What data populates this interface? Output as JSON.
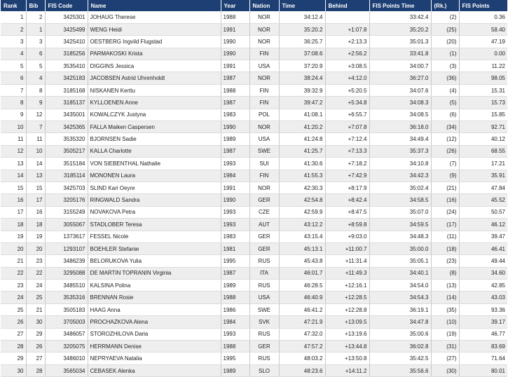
{
  "headers": {
    "rank": "Rank",
    "bib": "Bib",
    "fis_code": "FIS Code",
    "name": "Name",
    "year": "Year",
    "nation": "Nation",
    "time": "Time",
    "behind": "Behind",
    "fis_points_time": "FIS Points Time",
    "rk": "(Rk.)",
    "fis_points": "FIS Points"
  },
  "rows": [
    {
      "rank": "1",
      "bib": "2",
      "code": "3425301",
      "name": "JOHAUG Therese",
      "year": "1988",
      "nation": "NOR",
      "time": "34:12.4",
      "behind": "",
      "pt": "33:42.4",
      "rk": "(2)",
      "pts": "0.36"
    },
    {
      "rank": "2",
      "bib": "1",
      "code": "3425499",
      "name": "WENG Heidi",
      "year": "1991",
      "nation": "NOR",
      "time": "35:20.2",
      "behind": "+1:07.8",
      "pt": "35:20.2",
      "rk": "(25)",
      "pts": "58.40"
    },
    {
      "rank": "3",
      "bib": "3",
      "code": "3425410",
      "name": "OESTBERG Ingvild Flugstad",
      "year": "1990",
      "nation": "NOR",
      "time": "36:25.7",
      "behind": "+2:13.3",
      "pt": "35:01.3",
      "rk": "(20)",
      "pts": "47.19"
    },
    {
      "rank": "4",
      "bib": "6",
      "code": "3185256",
      "name": "PARMAKOSKI Krista",
      "year": "1990",
      "nation": "FIN",
      "time": "37:08.6",
      "behind": "+2:56.2",
      "pt": "33:41.8",
      "rk": "(1)",
      "pts": "0.00"
    },
    {
      "rank": "5",
      "bib": "5",
      "code": "3535410",
      "name": "DIGGINS Jessica",
      "year": "1991",
      "nation": "USA",
      "time": "37:20.9",
      "behind": "+3:08.5",
      "pt": "34:00.7",
      "rk": "(3)",
      "pts": "11.22"
    },
    {
      "rank": "6",
      "bib": "4",
      "code": "3425183",
      "name": "JACOBSEN Astrid Uhrenholdt",
      "year": "1987",
      "nation": "NOR",
      "time": "38:24.4",
      "behind": "+4:12.0",
      "pt": "36:27.0",
      "rk": "(36)",
      "pts": "98.05"
    },
    {
      "rank": "7",
      "bib": "8",
      "code": "3185168",
      "name": "NISKANEN Kerttu",
      "year": "1988",
      "nation": "FIN",
      "time": "39:32.9",
      "behind": "+5:20.5",
      "pt": "34:07.6",
      "rk": "(4)",
      "pts": "15.31"
    },
    {
      "rank": "8",
      "bib": "9",
      "code": "3185137",
      "name": "KYLLOENEN Anne",
      "year": "1987",
      "nation": "FIN",
      "time": "39:47.2",
      "behind": "+5:34.8",
      "pt": "34:08.3",
      "rk": "(5)",
      "pts": "15.73"
    },
    {
      "rank": "9",
      "bib": "12",
      "code": "3435001",
      "name": "KOWALCZYK Justyna",
      "year": "1983",
      "nation": "POL",
      "time": "41:08.1",
      "behind": "+6:55.7",
      "pt": "34:08.5",
      "rk": "(6)",
      "pts": "15.85"
    },
    {
      "rank": "10",
      "bib": "7",
      "code": "3425365",
      "name": "FALLA Maiken Caspersen",
      "year": "1990",
      "nation": "NOR",
      "time": "41:20.2",
      "behind": "+7:07.8",
      "pt": "36:18.0",
      "rk": "(34)",
      "pts": "92.71"
    },
    {
      "rank": "11",
      "bib": "11",
      "code": "3535320",
      "name": "BJORNSEN Sadie",
      "year": "1989",
      "nation": "USA",
      "time": "41:24.8",
      "behind": "+7:12.4",
      "pt": "34:49.4",
      "rk": "(12)",
      "pts": "40.12"
    },
    {
      "rank": "12",
      "bib": "10",
      "code": "3505217",
      "name": "KALLA Charlotte",
      "year": "1987",
      "nation": "SWE",
      "time": "41:25.7",
      "behind": "+7:13.3",
      "pt": "35:37.3",
      "rk": "(26)",
      "pts": "68.55"
    },
    {
      "rank": "13",
      "bib": "14",
      "code": "3515184",
      "name": "VON SIEBENTHAL Nathalie",
      "year": "1993",
      "nation": "SUI",
      "time": "41:30.6",
      "behind": "+7:18.2",
      "pt": "34:10.8",
      "rk": "(7)",
      "pts": "17.21"
    },
    {
      "rank": "14",
      "bib": "13",
      "code": "3185114",
      "name": "MONONEN Laura",
      "year": "1984",
      "nation": "FIN",
      "time": "41:55.3",
      "behind": "+7:42.9",
      "pt": "34:42.3",
      "rk": "(9)",
      "pts": "35.91"
    },
    {
      "rank": "15",
      "bib": "15",
      "code": "3425703",
      "name": "SLIND Kari Oeyre",
      "year": "1991",
      "nation": "NOR",
      "time": "42:30.3",
      "behind": "+8:17.9",
      "pt": "35:02.4",
      "rk": "(21)",
      "pts": "47.84"
    },
    {
      "rank": "16",
      "bib": "17",
      "code": "3205176",
      "name": "RINGWALD Sandra",
      "year": "1990",
      "nation": "GER",
      "time": "42:54.8",
      "behind": "+8:42.4",
      "pt": "34:58.5",
      "rk": "(16)",
      "pts": "45.52"
    },
    {
      "rank": "17",
      "bib": "16",
      "code": "3155249",
      "name": "NOVAKOVA Petra",
      "year": "1993",
      "nation": "CZE",
      "time": "42:59.9",
      "behind": "+8:47.5",
      "pt": "35:07.0",
      "rk": "(24)",
      "pts": "50.57"
    },
    {
      "rank": "18",
      "bib": "18",
      "code": "3055067",
      "name": "STADLOBER Teresa",
      "year": "1993",
      "nation": "AUT",
      "time": "43:12.2",
      "behind": "+8:59.8",
      "pt": "34:59.5",
      "rk": "(17)",
      "pts": "46.12"
    },
    {
      "rank": "19",
      "bib": "19",
      "code": "1373617",
      "name": "FESSEL Nicole",
      "year": "1983",
      "nation": "GER",
      "time": "43:15.4",
      "behind": "+9:03.0",
      "pt": "34:48.3",
      "rk": "(11)",
      "pts": "39.47"
    },
    {
      "rank": "20",
      "bib": "20",
      "code": "1293107",
      "name": "BOEHLER Stefanie",
      "year": "1981",
      "nation": "GER",
      "time": "45:13.1",
      "behind": "+11:00.7",
      "pt": "35:00.0",
      "rk": "(18)",
      "pts": "46.41"
    },
    {
      "rank": "21",
      "bib": "23",
      "code": "3486239",
      "name": "BELORUKOVA Yulia",
      "year": "1995",
      "nation": "RUS",
      "time": "45:43.8",
      "behind": "+11:31.4",
      "pt": "35:05.1",
      "rk": "(23)",
      "pts": "49.44"
    },
    {
      "rank": "22",
      "bib": "22",
      "code": "3295088",
      "name": "DE MARTIN TOPRANIN Virginia",
      "year": "1987",
      "nation": "ITA",
      "time": "46:01.7",
      "behind": "+11:49.3",
      "pt": "34:40.1",
      "rk": "(8)",
      "pts": "34.60"
    },
    {
      "rank": "23",
      "bib": "24",
      "code": "3485510",
      "name": "KALSINA Polina",
      "year": "1989",
      "nation": "RUS",
      "time": "46:28.5",
      "behind": "+12:16.1",
      "pt": "34:54.0",
      "rk": "(13)",
      "pts": "42.85"
    },
    {
      "rank": "24",
      "bib": "25",
      "code": "3535316",
      "name": "BRENNAN Rosie",
      "year": "1988",
      "nation": "USA",
      "time": "46:40.9",
      "behind": "+12:28.5",
      "pt": "34:54.3",
      "rk": "(14)",
      "pts": "43.03"
    },
    {
      "rank": "25",
      "bib": "21",
      "code": "3505183",
      "name": "HAAG Anna",
      "year": "1986",
      "nation": "SWE",
      "time": "46:41.2",
      "behind": "+12:28.8",
      "pt": "36:19.1",
      "rk": "(35)",
      "pts": "93.36"
    },
    {
      "rank": "26",
      "bib": "30",
      "code": "3705003",
      "name": "PROCHAZKOVA Alena",
      "year": "1984",
      "nation": "SVK",
      "time": "47:21.9",
      "behind": "+13:09.5",
      "pt": "34:47.8",
      "rk": "(10)",
      "pts": "39.17"
    },
    {
      "rank": "27",
      "bib": "29",
      "code": "3486057",
      "name": "STOROZHILOVA Daria",
      "year": "1993",
      "nation": "RUS",
      "time": "47:32.0",
      "behind": "+13:19.6",
      "pt": "35:00.6",
      "rk": "(19)",
      "pts": "46.77"
    },
    {
      "rank": "28",
      "bib": "26",
      "code": "3205075",
      "name": "HERRMANN Denise",
      "year": "1988",
      "nation": "GER",
      "time": "47:57.2",
      "behind": "+13:44.8",
      "pt": "36:02.8",
      "rk": "(31)",
      "pts": "83.69"
    },
    {
      "rank": "29",
      "bib": "27",
      "code": "3486010",
      "name": "NEPRYAEVA Natalia",
      "year": "1995",
      "nation": "RUS",
      "time": "48:03.2",
      "behind": "+13:50.8",
      "pt": "35:42.5",
      "rk": "(27)",
      "pts": "71.64"
    },
    {
      "rank": "30",
      "bib": "28",
      "code": "3565034",
      "name": "CEBASEK Alenka",
      "year": "1989",
      "nation": "SLO",
      "time": "48:23.6",
      "behind": "+14:11.2",
      "pt": "35:56.6",
      "rk": "(30)",
      "pts": "80.01"
    }
  ]
}
